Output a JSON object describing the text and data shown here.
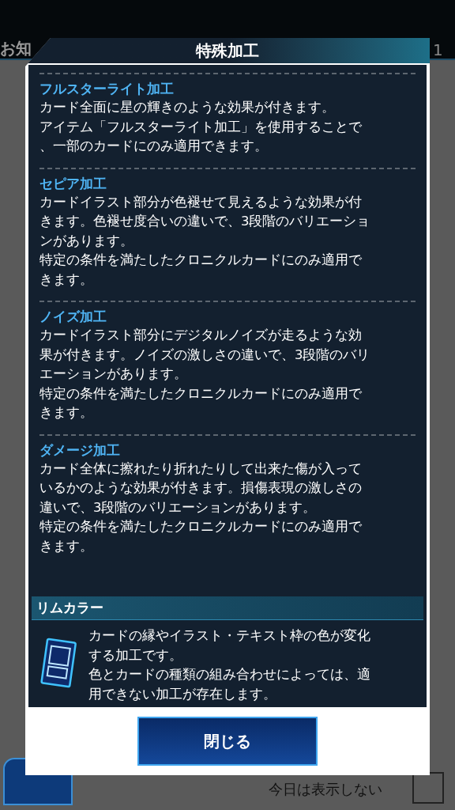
{
  "background": {
    "header_title": "お知",
    "header_counter": "1",
    "dont_show_today": {
      "label": "今日は表示しない",
      "checked": false
    }
  },
  "dialog": {
    "title": "特殊加工",
    "sections": [
      {
        "heading": "フルスターライト加工",
        "lines": [
          "カード全面に星の輝きのような効果が付きます。",
          "アイテム「フルスターライト加工」を使用することで",
          "、一部のカードにのみ適用できます。"
        ]
      },
      {
        "heading": "セピア加工",
        "lines": [
          "カードイラスト部分が色褪せて見えるような効果が付",
          "きます。色褪せ度合いの違いで、3段階のバリエーショ",
          "ンがあります。",
          "特定の条件を満たしたクロニクルカードにのみ適用で",
          "きます。"
        ]
      },
      {
        "heading": "ノイズ加工",
        "lines": [
          "カードイラスト部分にデジタルノイズが走るような効",
          "果が付きます。ノイズの激しさの違いで、3段階のバリ",
          "エーションがあります。",
          "特定の条件を満たしたクロニクルカードにのみ適用で",
          "きます。"
        ]
      },
      {
        "heading": "ダメージ加工",
        "lines": [
          "カード全体に擦れたり折れたりして出来た傷が入って",
          "いるかのような効果が付きます。損傷表現の激しさの",
          "違いで、3段階のバリエーションがあります。",
          "特定の条件を満たしたクロニクルカードにのみ適用で",
          "きます。"
        ]
      }
    ],
    "rim_color": {
      "heading": "リムカラー",
      "lines": [
        "カードの縁やイラスト・テキスト枠の色が変化",
        "する加工です。",
        "色とカードの種類の組み合わせによっては、適",
        "用できない加工が存在します。"
      ]
    },
    "close_button": "閉じる"
  }
}
